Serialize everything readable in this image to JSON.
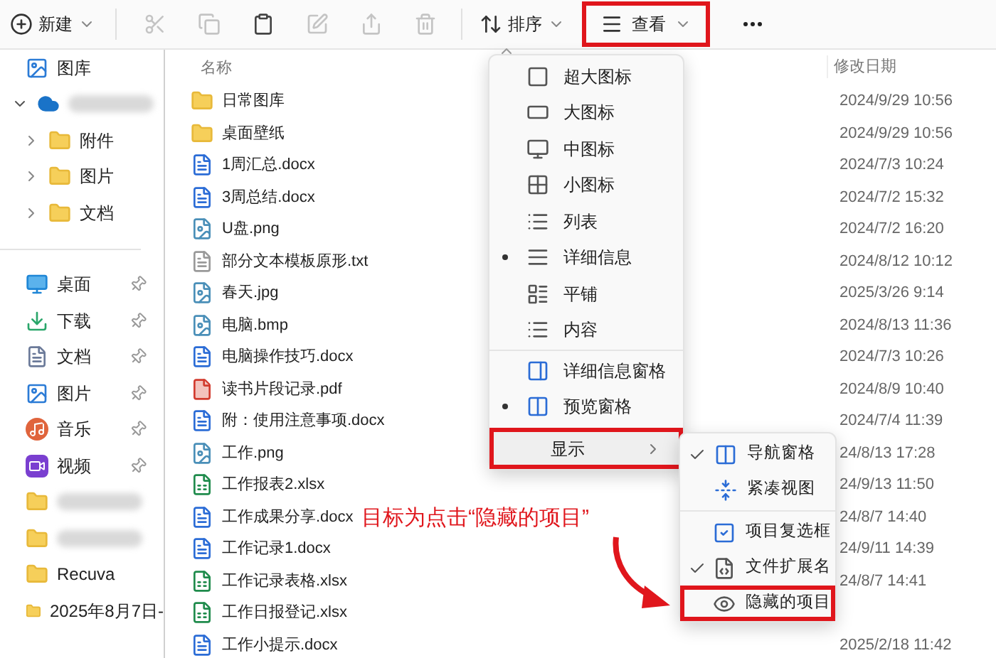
{
  "toolbar": {
    "new_button": {
      "label": "新建"
    },
    "actions": [
      {
        "disabled": true
      },
      {
        "disabled": true
      },
      {
        "disabled": false
      },
      {
        "disabled": true
      },
      {
        "disabled": true
      },
      {
        "disabled": true
      }
    ],
    "sort_button": {
      "label": "排序"
    },
    "view_button": {
      "label": "查看",
      "highlighted": true
    }
  },
  "navigation": {
    "items": [
      {
        "kind": "gallery",
        "label": "图库"
      },
      {
        "kind": "cloud",
        "blurred": true,
        "expanded": true,
        "children": [
          {
            "kind": "folder",
            "label": "附件",
            "expanded": false
          },
          {
            "kind": "folder",
            "label": "图片",
            "expanded": false
          },
          {
            "kind": "folder",
            "label": "文档",
            "expanded": false
          }
        ]
      }
    ],
    "quick_access": [
      {
        "kind": "desktop",
        "label": "桌面",
        "pinned": true
      },
      {
        "kind": "downloads",
        "label": "下载",
        "pinned": true
      },
      {
        "kind": "documents",
        "label": "文档",
        "pinned": true
      },
      {
        "kind": "pictures",
        "label": "图片",
        "pinned": true
      },
      {
        "kind": "music",
        "label": "音乐",
        "pinned": true
      },
      {
        "kind": "videos",
        "label": "视频",
        "pinned": true
      },
      {
        "kind": "folder",
        "blurred": true,
        "pinned": false
      },
      {
        "kind": "folder",
        "blurred": true,
        "pinned": false
      },
      {
        "kind": "folder",
        "label": "Recuva",
        "pinned": false
      },
      {
        "kind": "folder",
        "label": "2025年8月7日-",
        "pinned": false
      }
    ]
  },
  "files": {
    "columns": [
      "名称",
      "修改日期"
    ],
    "rows": [
      {
        "kind": "folder",
        "name": "日常图库",
        "modified": "2024/9/29 10:56"
      },
      {
        "kind": "folder",
        "name": "桌面壁纸",
        "modified": "2024/9/29 10:56"
      },
      {
        "kind": "word",
        "name": "1周汇总.docx",
        "modified": "2024/7/3 10:24"
      },
      {
        "kind": "word",
        "name": "3周总结.docx",
        "modified": "2024/7/2 15:32"
      },
      {
        "kind": "image",
        "name": "U盘.png",
        "modified": "2024/7/2 16:20"
      },
      {
        "kind": "text",
        "name": "部分文本模板原形.txt",
        "modified": "2024/8/12 10:12"
      },
      {
        "kind": "image",
        "name": "春天.jpg",
        "modified": "2025/3/26 9:14"
      },
      {
        "kind": "image",
        "name": "电脑.bmp",
        "modified": "2024/8/13 11:36"
      },
      {
        "kind": "word",
        "name": "电脑操作技巧.docx",
        "modified": "2024/7/3 10:26"
      },
      {
        "kind": "pdf",
        "name": "读书片段记录.pdf",
        "modified": "2024/8/9 10:40"
      },
      {
        "kind": "word",
        "name": "附：使用注意事项.docx",
        "modified": "2024/7/4 11:39"
      },
      {
        "kind": "image",
        "name": "工作.png",
        "modified": "24/8/13 17:28"
      },
      {
        "kind": "excel",
        "name": "工作报表2.xlsx",
        "modified": "24/9/13 11:50"
      },
      {
        "kind": "word",
        "name": "工作成果分享.docx",
        "modified": "24/8/7 14:40"
      },
      {
        "kind": "word",
        "name": "工作记录1.docx",
        "modified": "24/9/11 14:39"
      },
      {
        "kind": "excel",
        "name": "工作记录表格.xlsx",
        "modified": "24/8/7 14:41"
      },
      {
        "kind": "excel",
        "name": "工作日报登记.xlsx"
      },
      {
        "kind": "word",
        "name": "工作小提示.docx",
        "modified": "2025/2/18 11:42"
      }
    ]
  },
  "view_menu": {
    "items": [
      {
        "kind": "xlarge",
        "label": "超大图标",
        "selected": false
      },
      {
        "kind": "large",
        "label": "大图标",
        "selected": false
      },
      {
        "kind": "medium",
        "label": "中图标",
        "selected": false
      },
      {
        "kind": "small",
        "label": "小图标",
        "selected": false
      },
      {
        "kind": "list",
        "label": "列表",
        "selected": false
      },
      {
        "kind": "details",
        "label": "详细信息",
        "selected": true
      },
      {
        "kind": "tiles",
        "label": "平铺",
        "selected": false
      },
      {
        "kind": "content",
        "label": "内容",
        "selected": false
      },
      {
        "kind": "separator"
      },
      {
        "kind": "detailspane",
        "label": "详细信息窗格",
        "selected": false
      },
      {
        "kind": "previewpane",
        "label": "预览窗格",
        "selected": true
      },
      {
        "kind": "show",
        "label": "显示",
        "highlighted": true
      }
    ]
  },
  "show_submenu": {
    "items": [
      {
        "kind": "navpane",
        "label": "导航窗格",
        "checked": true,
        "highlighted": false
      },
      {
        "kind": "compact",
        "label": "紧凑视图",
        "checked": false,
        "highlighted": false
      },
      {
        "kind": "separator"
      },
      {
        "kind": "checkboxes",
        "label": "项目复选框",
        "checked": false,
        "highlighted": false
      },
      {
        "kind": "extensions",
        "label": "文件扩展名",
        "checked": true,
        "highlighted": false
      },
      {
        "kind": "hidden",
        "label": "隐藏的项目",
        "checked": false,
        "highlighted": true
      }
    ]
  },
  "annotation": {
    "text": "目标为点击“隐藏的项目”"
  }
}
